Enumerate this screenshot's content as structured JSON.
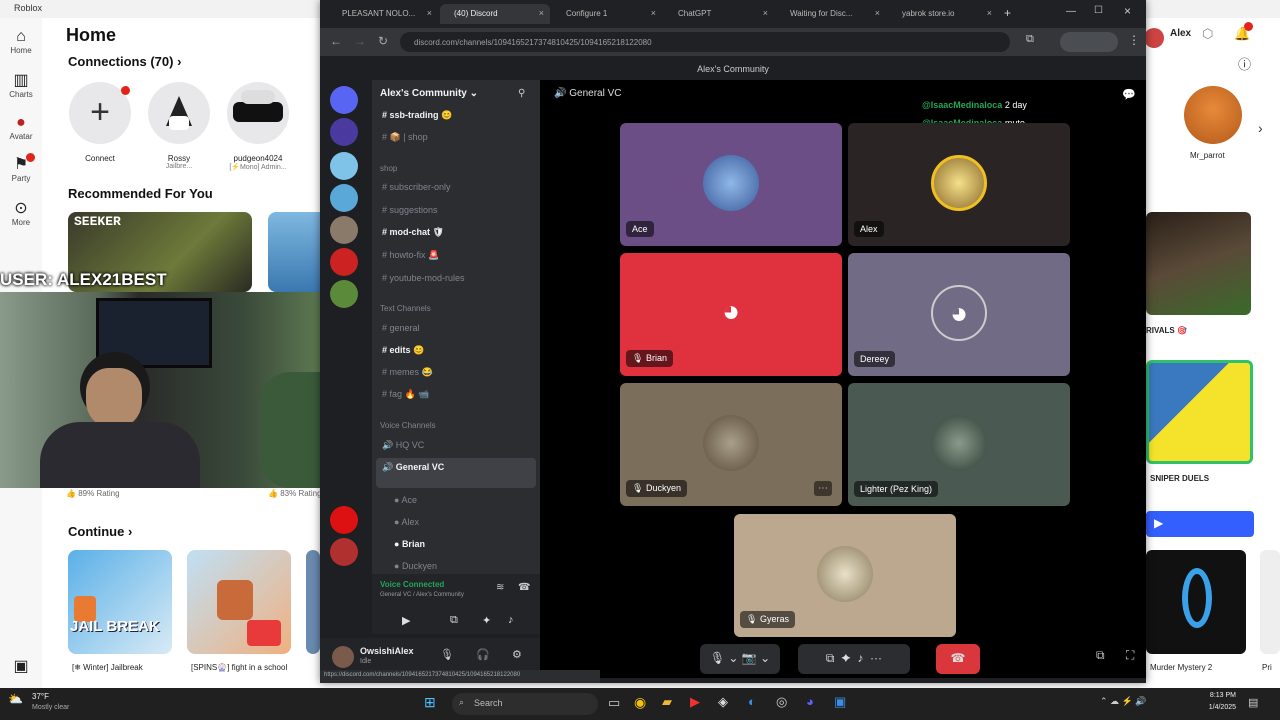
{
  "roblox": {
    "window_title": "Roblox",
    "nav": [
      {
        "label": "Home",
        "icon": "home-icon"
      },
      {
        "label": "Charts",
        "icon": "charts-icon"
      },
      {
        "label": "Avatar",
        "icon": "avatar-icon"
      },
      {
        "label": "Party",
        "icon": "party-icon"
      },
      {
        "label": "More",
        "icon": "more-icon"
      }
    ],
    "page_title": "Home",
    "connections_heading": "Connections (70)",
    "connections": [
      {
        "name": "Connect",
        "sub": ""
      },
      {
        "name": "Rossy",
        "sub": "Jailbre..."
      },
      {
        "name": "pudgeon4024",
        "sub": "[⚡Mono] Admin..."
      }
    ],
    "recommended_heading": "Recommended For You",
    "rec_tile_label": "SEEKER",
    "overlay_name": "USER: ALEX21BEST",
    "rating_left": "89% Rating",
    "rating_right": "83% Rating",
    "continue_heading": "Continue",
    "continue_items": [
      {
        "title": "[❄ Winter] Jailbreak",
        "art": "JAIL BREAK"
      },
      {
        "title": "[SPINS🎡] fight in a school",
        "art": ""
      }
    ],
    "user_name": "Alex",
    "right_connection": "Mr_parrot",
    "right_labels": {
      "rivals": "RIVALS 🎯",
      "sniper": "SNIPER DUELS",
      "murder": "Murder Mystery 2",
      "prison": "Pri"
    }
  },
  "browser": {
    "tabs": [
      {
        "title": "PLEASANT NOLO..."
      },
      {
        "title": "(40) Discord"
      },
      {
        "title": "Configure 1"
      },
      {
        "title": "ChatGPT"
      },
      {
        "title": "Waiting for Disc..."
      },
      {
        "title": "yabrok store.io"
      }
    ],
    "url": "discord.com/channels/1094165217374810425/1094165218122080"
  },
  "discord": {
    "window_title": "Alex's Community",
    "server_name": "Alex's Community",
    "channels": [
      {
        "name": "ssb-trading 😊",
        "bold": true
      },
      {
        "name": "📦 | shop"
      },
      {
        "name": "shop"
      },
      {
        "name": "subscriber-only"
      },
      {
        "name": "suggestions"
      },
      {
        "name": "mod-chat 🛡",
        "bold": true
      },
      {
        "name": "howto-fix 🚨"
      },
      {
        "name": "youtube-mod-rules"
      },
      {
        "name": "general"
      },
      {
        "name": "edits 😊",
        "bold": true
      },
      {
        "name": "memes 😂"
      },
      {
        "name": "fag 🔥 📹"
      },
      {
        "name": "HQ VC"
      },
      {
        "name": "General VC",
        "bold": true
      }
    ],
    "categories": [
      "shop",
      "Text Channels",
      "Voice Channels"
    ],
    "vc_members": [
      "Ace",
      "Alex",
      "Brian",
      "Duckyen"
    ],
    "voice_status": "Voice Connected",
    "voice_sub": "General VC / Alex's Community",
    "user": {
      "name": "OwsishiAlex",
      "status": "Idle"
    },
    "call_title": "General VC",
    "notices": [
      {
        "handle": "@IsaacMedinaloca",
        "text": "2 day"
      },
      {
        "handle": "@IsaacMedinaloca",
        "text": "mute"
      }
    ],
    "participants": [
      {
        "name": "Ace"
      },
      {
        "name": "Alex"
      },
      {
        "name": "Brian"
      },
      {
        "name": "Dereey"
      },
      {
        "name": "Duckyen"
      },
      {
        "name": "Lighter (Pez King)"
      },
      {
        "name": "Gyeras"
      }
    ],
    "status_url": "https://discord.com/channels/1094165217374810425/1094165218122080"
  },
  "taskbar": {
    "weather_temp": "37°F",
    "weather_desc": "Mostly clear",
    "search_placeholder": "Search",
    "time": "8:13 PM",
    "date": "1/4/2025"
  },
  "colors": {
    "discord_dark": "#1e1f22",
    "tile_purple": "#6b4e86",
    "tile_red": "#e0323e",
    "tile_gray": "#716b85",
    "tile_tan": "#7b6e5b",
    "tile_green": "#4a5a52",
    "discord_blurple": "#5865f2",
    "mention_green": "#23a55a"
  }
}
